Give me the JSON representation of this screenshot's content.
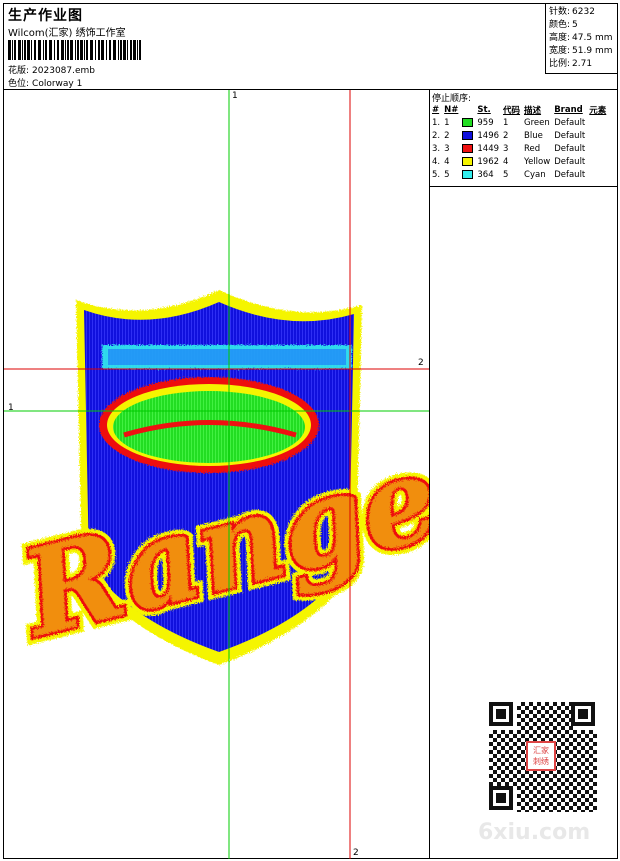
{
  "header": {
    "title": "生产作业图",
    "studio": "Wilcom(汇家) 绣饰工作室",
    "design_label": "花版:",
    "design_value": "2023087.emb",
    "colorway_label": "色位:",
    "colorway_value": "Colorway 1"
  },
  "specs": {
    "stitches_label": "针数:",
    "stitches_value": "6232",
    "colors_label": "颜色:",
    "colors_value": "5",
    "height_label": "高度:",
    "height_value": "47.5 mm",
    "width_label": "宽度:",
    "width_value": "51.9 mm",
    "ratio_label": "比例:",
    "ratio_value": "2.71"
  },
  "stop_sequence": {
    "title": "停止顺序:",
    "columns": [
      "#",
      "N#",
      "St.",
      "代码",
      "描述",
      "Brand",
      "元素"
    ],
    "rows": [
      {
        "num": "1.",
        "n": "1",
        "color": "#22dd22",
        "st": "959",
        "code": "1",
        "desc": "Green",
        "brand": "Default"
      },
      {
        "num": "2.",
        "n": "2",
        "color": "#1010dd",
        "st": "1496",
        "code": "2",
        "desc": "Blue",
        "brand": "Default"
      },
      {
        "num": "3.",
        "n": "3",
        "color": "#ee1111",
        "st": "1449",
        "code": "3",
        "desc": "Red",
        "brand": "Default"
      },
      {
        "num": "4.",
        "n": "4",
        "color": "#f5f500",
        "st": "1962",
        "code": "4",
        "desc": "Yellow",
        "brand": "Default"
      },
      {
        "num": "5.",
        "n": "5",
        "color": "#33eeee",
        "st": "364",
        "code": "5",
        "desc": "Cyan",
        "brand": "Default"
      }
    ]
  },
  "guides": {
    "g1_top": "1",
    "g1_left": "1",
    "g2_right": "2",
    "g2_bottom": "2"
  },
  "design": {
    "script_text": "Rangers",
    "colors": {
      "green": "#22dd22",
      "blue": "#1010dd",
      "red": "#ee1111",
      "yellow": "#f5f500",
      "cyan": "#33eeee",
      "guide_green": "#00cc00",
      "guide_red": "#dd0000"
    }
  },
  "watermark": {
    "brand": "6xiu.com",
    "seal": "汇家刺绣"
  }
}
